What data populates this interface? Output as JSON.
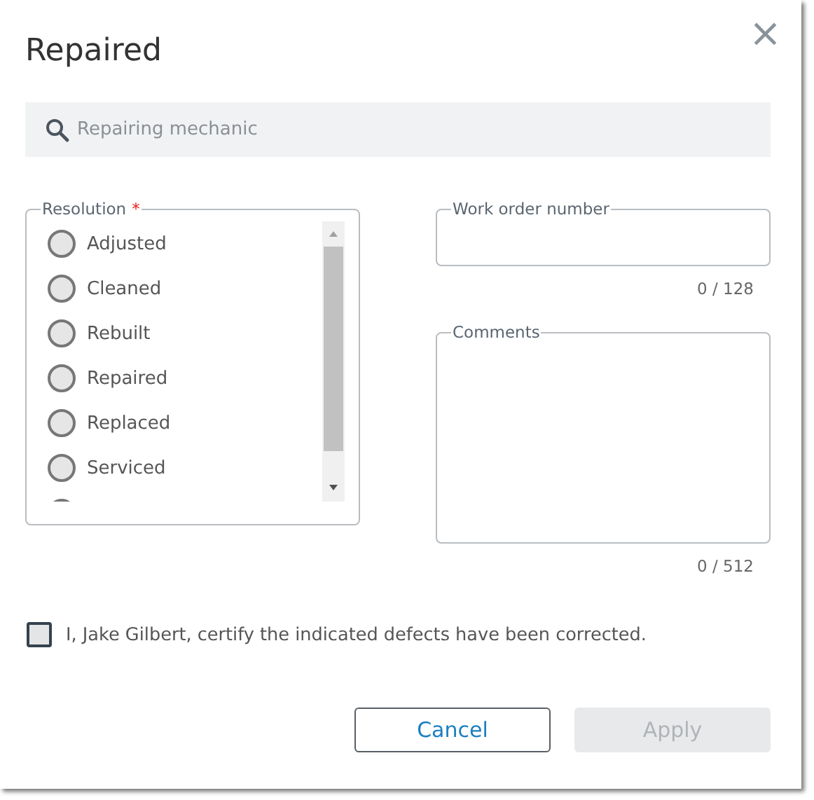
{
  "dialog": {
    "title": "Repaired",
    "close_icon": "×"
  },
  "search": {
    "placeholder": "Repairing mechanic"
  },
  "resolution": {
    "label": "Resolution",
    "required_mark": "*",
    "options": [
      {
        "label": "Adjusted",
        "selected": false
      },
      {
        "label": "Cleaned",
        "selected": false
      },
      {
        "label": "Rebuilt",
        "selected": false
      },
      {
        "label": "Repaired",
        "selected": false
      },
      {
        "label": "Replaced",
        "selected": false
      },
      {
        "label": "Serviced",
        "selected": false
      }
    ]
  },
  "work_order": {
    "label": "Work order number",
    "counter": "0 / 128"
  },
  "comments": {
    "label": "Comments",
    "counter": "0 / 512"
  },
  "certify": {
    "label": "I, Jake Gilbert, certify the indicated defects have been corrected.",
    "checked": false
  },
  "buttons": [
    {
      "label": "Cancel",
      "kind": "secondary",
      "disabled": false
    },
    {
      "label": "Apply",
      "kind": "primary",
      "disabled": true
    }
  ]
}
